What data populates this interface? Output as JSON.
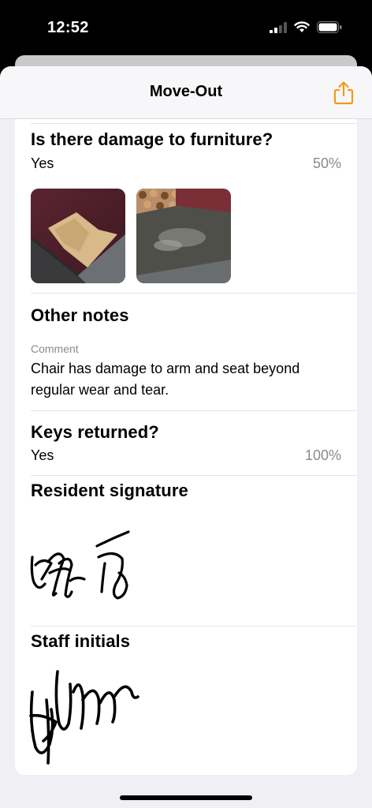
{
  "status_bar": {
    "time": "12:52"
  },
  "nav": {
    "title": "Move-Out",
    "share_icon": "share-icon"
  },
  "colors": {
    "accent": "#f19a1b",
    "secondary_text": "#8a8a8e",
    "background": "#efeff4"
  },
  "furniture": {
    "question": "Is there damage to furniture?",
    "answer": "Yes",
    "percent": "50%",
    "photos": [
      "furniture-damage-photo-1",
      "furniture-damage-photo-2"
    ]
  },
  "notes": {
    "title": "Other notes",
    "comment_label": "Comment",
    "comment": "Chair has damage to arm and seat beyond regular wear and tear."
  },
  "keys": {
    "question": "Keys returned?",
    "answer": "Yes",
    "percent": "100%"
  },
  "resident_signature": {
    "title": "Resident signature"
  },
  "staff_initials": {
    "title": "Staff initials"
  }
}
